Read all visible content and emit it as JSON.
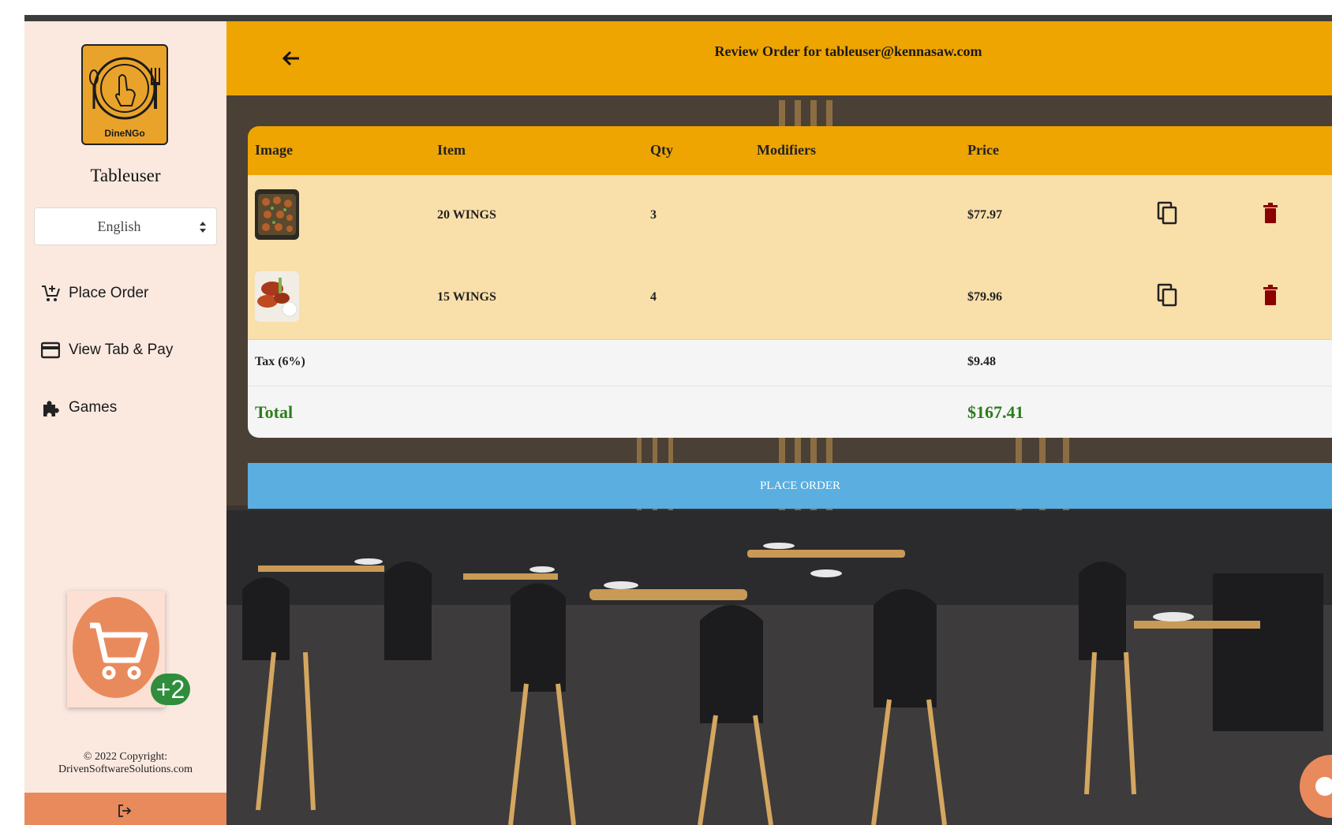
{
  "sidebar": {
    "logo_text": "DineNGo",
    "username": "Tableuser",
    "language": "English",
    "nav": [
      {
        "label": "Place Order",
        "icon": "cart-plus-icon"
      },
      {
        "label": "View Tab & Pay",
        "icon": "credit-card-icon"
      },
      {
        "label": "Games",
        "icon": "puzzle-icon"
      }
    ],
    "cart_badge": "+2",
    "copyright_line1": "© 2022 Copyright:",
    "copyright_line2": "DrivenSoftwareSolutions.com"
  },
  "header": {
    "title": "Review Order for tableuser@kennasaw.com"
  },
  "table": {
    "columns": [
      "Image",
      "Item",
      "Qty",
      "Modifiers",
      "Price"
    ],
    "rows": [
      {
        "item": "20 WINGS",
        "qty": "3",
        "modifiers": "",
        "price": "$77.97",
        "image": "platter-thumbnail"
      },
      {
        "item": "15 WINGS",
        "qty": "4",
        "modifiers": "",
        "price": "$79.96",
        "image": "wings-thumbnail"
      }
    ],
    "tax_label": "Tax (6%)",
    "tax_value": "$9.48",
    "total_label": "Total",
    "total_value": "$167.41"
  },
  "actions": {
    "place_order": "PLACE ORDER"
  },
  "colors": {
    "header": "#eea501",
    "row": "#f9dfa9",
    "sidebar": "#fbe9e0",
    "button": "#5aaee0",
    "total": "#2e7d1f",
    "trash": "#8b0000",
    "cart": "#e98a5d"
  }
}
